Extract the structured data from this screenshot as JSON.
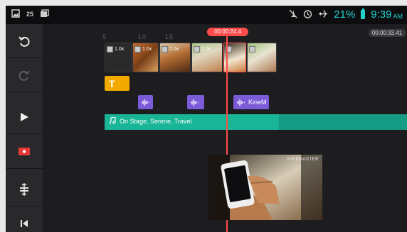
{
  "status_bar": {
    "left_icons": [
      "image-icon",
      "calendar-icon",
      "photos-icon"
    ],
    "calendar_number": "25",
    "right_icons": [
      "silent-icon",
      "alarm-icon",
      "airplane-icon"
    ],
    "battery_percent": "21%",
    "time": "9:39",
    "ampm": "AM",
    "accent_color": "#20d2c8"
  },
  "toolbar": {
    "items": [
      {
        "name": "undo-icon"
      },
      {
        "name": "redo-icon"
      },
      {
        "name": "play-icon"
      },
      {
        "name": "record-icon"
      },
      {
        "name": "layers-split-icon"
      },
      {
        "name": "skip-to-start-icon"
      }
    ]
  },
  "timeline": {
    "ruler": [
      "5",
      "10",
      "15"
    ],
    "playhead_time": "00:00:24.4",
    "end_time": "00:00:33.41",
    "clips": [
      {
        "speed": "1.0x",
        "thumb": "dark"
      },
      {
        "speed": "1.0x",
        "thumb": "orange"
      },
      {
        "speed": "1.0x",
        "thumb": "orange2"
      },
      {
        "speed": "1.0x",
        "thumb": "green"
      },
      {
        "speed": "",
        "thumb": "phone"
      },
      {
        "speed": "",
        "thumb": "green2"
      }
    ],
    "title_clip_label": "T",
    "audio_clips": [
      {
        "label": ""
      },
      {
        "label": ""
      },
      {
        "label": "KineM"
      }
    ],
    "music_track_label": "On Stage, Serene, Travel",
    "preview_brand": "KINEMASTER",
    "colors": {
      "playhead": "#ff4b4b",
      "title_clip": "#f2a900",
      "audio_clip": "#7b5bd8",
      "music_track": "#18b596"
    }
  }
}
